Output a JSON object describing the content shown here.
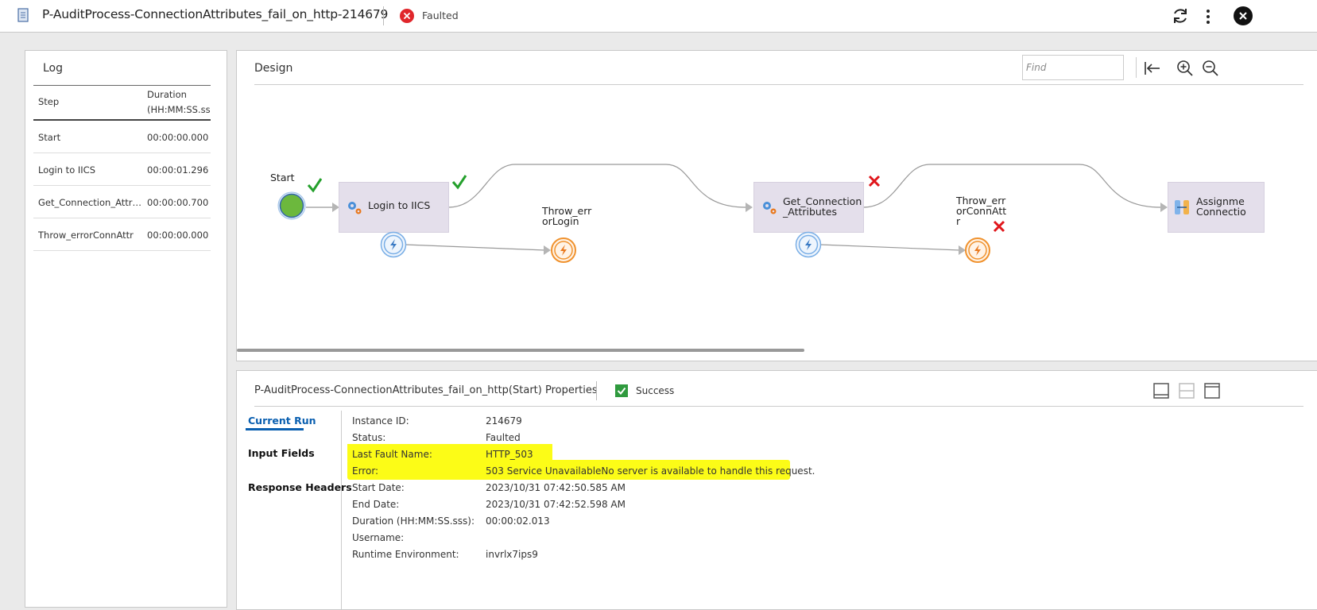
{
  "header": {
    "title": "P-AuditProcess-ConnectionAttributes_fail_on_http-214679",
    "status": "Faulted",
    "icons": [
      "process-doc-icon",
      "faulted-icon",
      "refresh-icon",
      "more-options-icon",
      "close-icon"
    ]
  },
  "log": {
    "title": "Log",
    "columns": {
      "step": "Step",
      "duration_line1": "Duration",
      "duration_line2": "(HH:MM:SS.sss)"
    },
    "rows": [
      {
        "step": "Start",
        "duration": "00:00:00.000"
      },
      {
        "step": "Login to IICS",
        "duration": "00:00:01.296"
      },
      {
        "step": "Get_Connection_Attributes",
        "duration": "00:00:00.700"
      },
      {
        "step": "Throw_errorConnAttr",
        "duration": "00:00:00.000"
      }
    ]
  },
  "design": {
    "title": "Design",
    "find_placeholder": "Find",
    "nodes": {
      "start": "Start",
      "login": "Login to IICS",
      "throw_login_1": "Throw_err",
      "throw_login_2": "orLogin",
      "getconn_1": "Get_Connection",
      "getconn_2": "_Attributes",
      "throw_conn_1": "Throw_err",
      "throw_conn_2": "orConnAtt",
      "throw_conn_3": "r",
      "assign_1": "Assignme",
      "assign_2": "Connectio"
    }
  },
  "properties": {
    "title": "P-AuditProcess-ConnectionAttributes_fail_on_http(Start) Properties",
    "status": "Success",
    "tabs": [
      "Current Run",
      "Input Fields",
      "Response Headers"
    ],
    "fields": [
      {
        "key": "Instance ID:",
        "value": "214679"
      },
      {
        "key": "Status:",
        "value": "Faulted"
      },
      {
        "key": "Last Fault Name:",
        "value": "HTTP_503"
      },
      {
        "key": "Error:",
        "value": "503 Service UnavailableNo server is available to handle this request."
      },
      {
        "key": "Start Date:",
        "value": "2023/10/31 07:42:50.585 AM"
      },
      {
        "key": "End Date:",
        "value": "2023/10/31 07:42:52.598 AM"
      },
      {
        "key": "Duration (HH:MM:SS.sss):",
        "value": "00:00:02.013"
      },
      {
        "key": "Username:",
        "value": ""
      },
      {
        "key": "Runtime Environment:",
        "value": "invrlx7ips9"
      }
    ]
  },
  "colors": {
    "accent": "#0a5fb0",
    "success": "#2f9a3e",
    "error": "#e0262b",
    "highlight": "#fcfc17",
    "node_fill": "#e4dfeb"
  }
}
